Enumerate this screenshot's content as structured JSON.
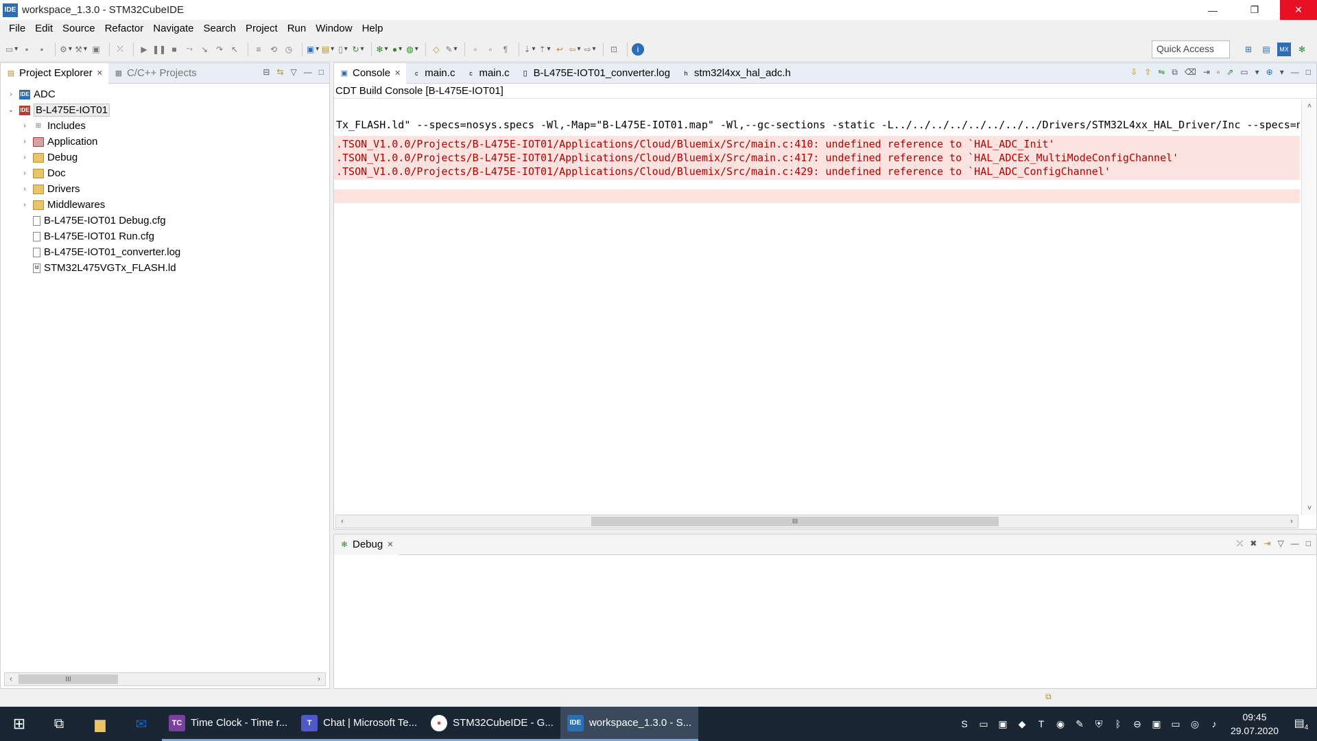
{
  "window": {
    "app_badge": "IDE",
    "title": "workspace_1.3.0 - STM32CubeIDE",
    "minimize": "—",
    "maximize": "❐",
    "close": "✕"
  },
  "menu": [
    "File",
    "Edit",
    "Source",
    "Refactor",
    "Navigate",
    "Search",
    "Project",
    "Run",
    "Window",
    "Help"
  ],
  "quick_access": {
    "placeholder": "Quick Access"
  },
  "project_explorer": {
    "tabs": [
      {
        "label": "Project Explorer",
        "active": true
      },
      {
        "label": "C/C++ Projects",
        "active": false
      }
    ],
    "tree": [
      {
        "label": "ADC",
        "level": 0,
        "expanded": false,
        "icon": "project-icon"
      },
      {
        "label": "B-L475E-IOT01",
        "level": 0,
        "expanded": true,
        "icon": "project-icon",
        "selected": true
      },
      {
        "label": "Includes",
        "level": 1,
        "expanded": false,
        "icon": "includes-icon"
      },
      {
        "label": "Application",
        "level": 1,
        "expanded": false,
        "icon": "folder-icon"
      },
      {
        "label": "Debug",
        "level": 1,
        "expanded": false,
        "icon": "folder-icon"
      },
      {
        "label": "Doc",
        "level": 1,
        "expanded": false,
        "icon": "folder-icon"
      },
      {
        "label": "Drivers",
        "level": 1,
        "expanded": false,
        "icon": "folder-icon"
      },
      {
        "label": "Middlewares",
        "level": 1,
        "expanded": false,
        "icon": "folder-icon"
      },
      {
        "label": "B-L475E-IOT01 Debug.cfg",
        "level": 1,
        "icon": "file-icon"
      },
      {
        "label": "B-L475E-IOT01 Run.cfg",
        "level": 1,
        "icon": "file-icon"
      },
      {
        "label": "B-L475E-IOT01_converter.log",
        "level": 1,
        "icon": "file-icon"
      },
      {
        "label": "STM32L475VGTx_FLASH.ld",
        "level": 1,
        "icon": "linker-file-icon"
      }
    ],
    "scroll_thumb": "III"
  },
  "editor_tabs": [
    {
      "label": "Console",
      "active": true,
      "closable": true
    },
    {
      "label": "main.c"
    },
    {
      "label": "main.c"
    },
    {
      "label": "B-L475E-IOT01_converter.log"
    },
    {
      "label": "stm32l4xx_hal_adc.h"
    }
  ],
  "console": {
    "title": "CDT Build Console [B-L475E-IOT01]",
    "lines": [
      "Tx_FLASH.ld\" --specs=nosys.specs -Wl,-Map=\"B-L475E-IOT01.map\" -Wl,--gc-sections -static -L../../../../../../../../Drivers/STM32L4xx_HAL_Driver/Inc --specs=na"
    ],
    "errors": [
      ".TSON_V1.0.0/Projects/B-L475E-IOT01/Applications/Cloud/Bluemix/Src/main.c:410: undefined reference to `HAL_ADC_Init'",
      ".TSON_V1.0.0/Projects/B-L475E-IOT01/Applications/Cloud/Bluemix/Src/main.c:417: undefined reference to `HAL_ADCEx_MultiModeConfigChannel'",
      ".TSON_V1.0.0/Projects/B-L475E-IOT01/Applications/Cloud/Bluemix/Src/main.c:429: undefined reference to `HAL_ADC_ConfigChannel'"
    ],
    "scroll_thumb": "III"
  },
  "debug_panel": {
    "tab_label": "Debug"
  },
  "taskbar": {
    "apps": [
      {
        "label": "Time Clock - Time r...",
        "badge": "TC",
        "color": "#7b3fa0"
      },
      {
        "label": "Chat | Microsoft Te...",
        "badge": "T",
        "color": "#5059c9"
      },
      {
        "label": "STM32CubeIDE - G...",
        "badge": "●",
        "color": "#db4437"
      },
      {
        "label": "workspace_1.3.0 - S...",
        "badge": "IDE",
        "color": "#2d6db5",
        "active": true
      }
    ],
    "time": "09:45",
    "date": "29.07.2020",
    "notification_count": "4"
  },
  "colors": {
    "accent": "#2d6db5",
    "error_bg": "#fde3df",
    "error_text": "#b00000",
    "taskbar_bg": "#1a2633"
  }
}
